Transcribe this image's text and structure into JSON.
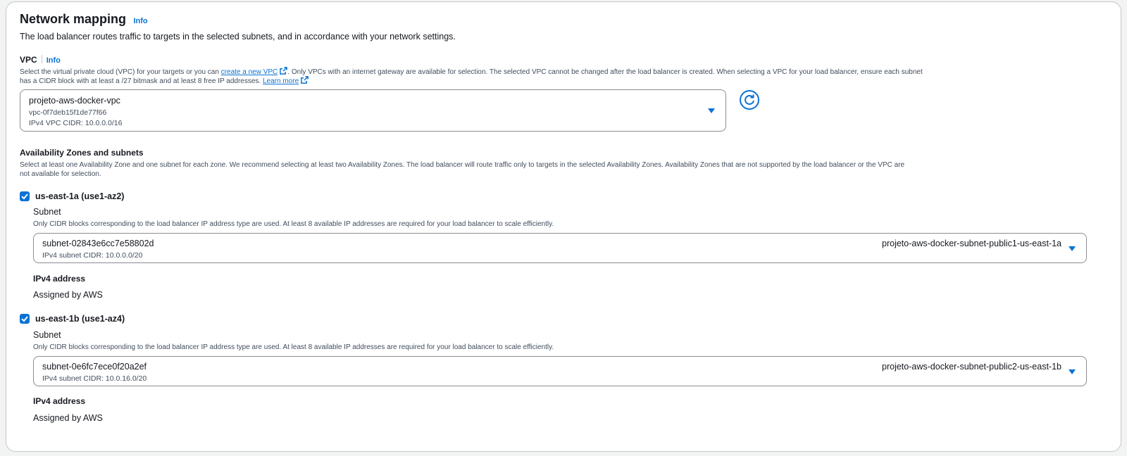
{
  "section": {
    "title": "Network mapping",
    "info": "Info",
    "description": "The load balancer routes traffic to targets in the selected subnets, and in accordance with your network settings."
  },
  "vpc": {
    "label": "VPC",
    "info": "Info",
    "help_prefix": "Select the virtual private cloud (VPC) for your targets or you can",
    "create_link": "create a new VPC",
    "help_middle": ". Only VPCs with an internet gateway are available for selection. The selected VPC cannot be changed after the load balancer is created. When selecting a VPC for your load balancer, ensure each subnet",
    "help_line2": "has a CIDR block with at least a /27 bitmask and at least 8 free IP addresses.",
    "learn_more": "Learn more",
    "selected_name": "projeto-aws-docker-vpc",
    "selected_id": "vpc-0f7deb15f1de77f66",
    "selected_cidr": "IPv4 VPC CIDR: 10.0.0.0/16"
  },
  "az": {
    "label": "Availability Zones and subnets",
    "help_line1": "Select at least one Availability Zone and one subnet for each zone. We recommend selecting at least two Availability Zones. The load balancer will route traffic only to targets in the selected Availability Zones. Availability Zones that are not supported by the load balancer or the VPC are",
    "help_line2": "not available for selection.",
    "zones": [
      {
        "name": "us-east-1a (use1-az2)",
        "subnet_label": "Subnet",
        "subnet_help": "Only CIDR blocks corresponding to the load balancer IP address type are used. At least 8 available IP addresses are required for your load balancer to scale efficiently.",
        "subnet_id": "subnet-02843e6cc7e58802d",
        "subnet_cidr": "IPv4 subnet CIDR: 10.0.0.0/20",
        "subnet_name": "projeto-aws-docker-subnet-public1-us-east-1a",
        "ipv4_label": "IPv4 address",
        "ipv4_value": "Assigned by AWS"
      },
      {
        "name": "us-east-1b (use1-az4)",
        "subnet_label": "Subnet",
        "subnet_help": "Only CIDR blocks corresponding to the load balancer IP address type are used. At least 8 available IP addresses are required for your load balancer to scale efficiently.",
        "subnet_id": "subnet-0e6fc7ece0f20a2ef",
        "subnet_cidr": "IPv4 subnet CIDR: 10.0.16.0/20",
        "subnet_name": "projeto-aws-docker-subnet-public2-us-east-1b",
        "ipv4_label": "IPv4 address",
        "ipv4_value": "Assigned by AWS"
      }
    ]
  },
  "colors": {
    "accent": "#0972d3",
    "border": "#8c8c94",
    "text": "#16191f"
  },
  "icons": {
    "external": "external-link-icon",
    "refresh": "refresh-icon",
    "caret": "caret-down-icon",
    "check": "check-icon"
  }
}
